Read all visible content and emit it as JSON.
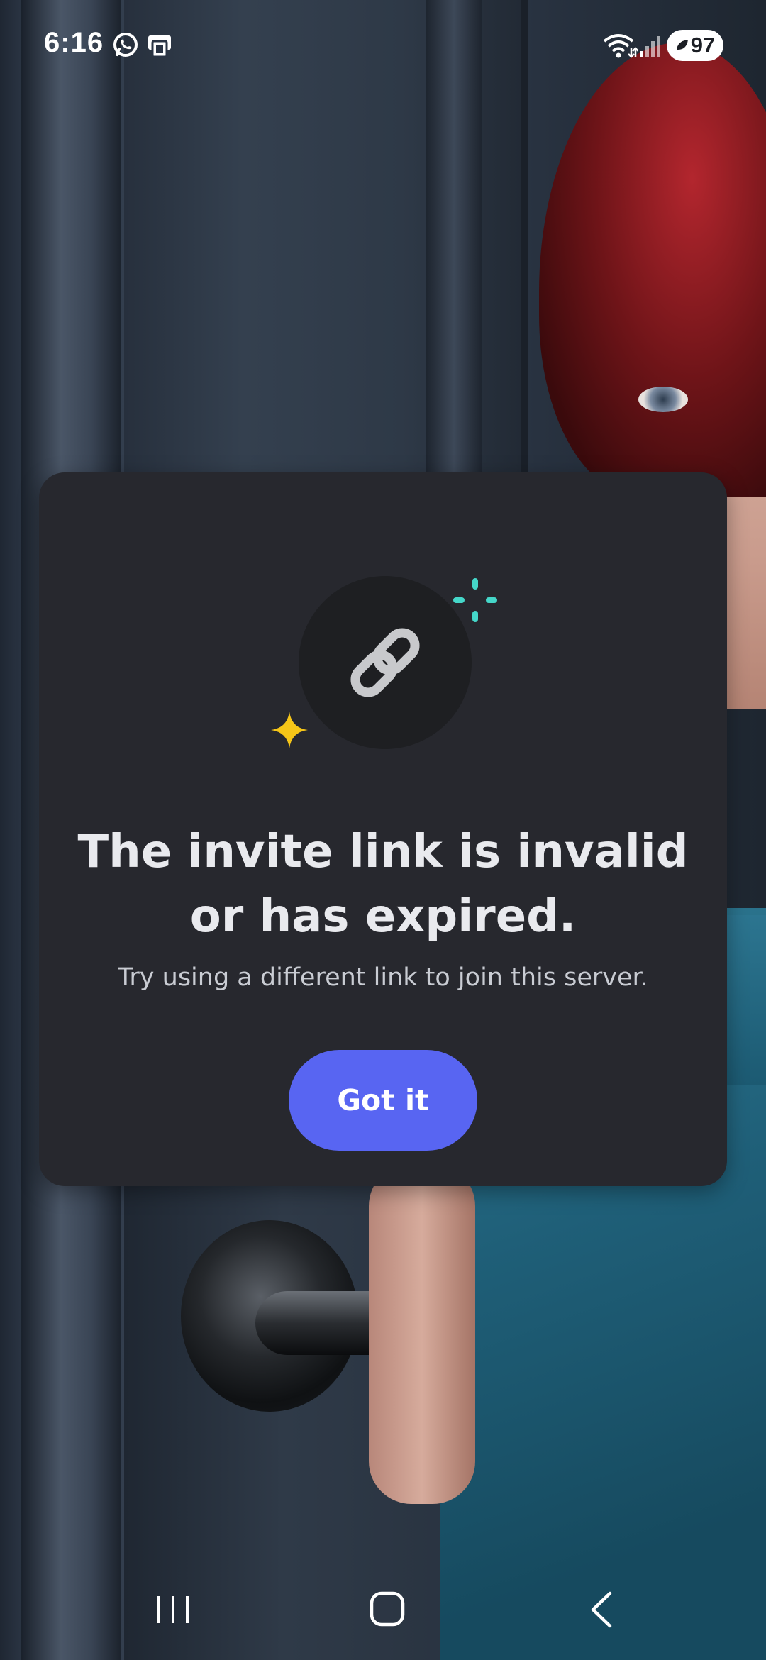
{
  "status_bar": {
    "time": "6:16",
    "battery_level": "97",
    "icons": [
      "whatsapp-icon",
      "phone-icon",
      "wifi-icon",
      "signal-icon",
      "battery-icon"
    ]
  },
  "dialog": {
    "title": "The invite link is invalid or has expired.",
    "subtitle": "Try using a different link to join this server.",
    "button_label": "Got it",
    "icon": "link-icon",
    "colors": {
      "dialog_background": "#27282e",
      "icon_circle": "#1e1f22",
      "button": "#5865f2",
      "sparkle_teal": "#45d7c9",
      "sparkle_yellow": "#f5c518"
    }
  },
  "nav_bar": {
    "icons": [
      "recents-icon",
      "home-icon",
      "back-icon"
    ]
  }
}
